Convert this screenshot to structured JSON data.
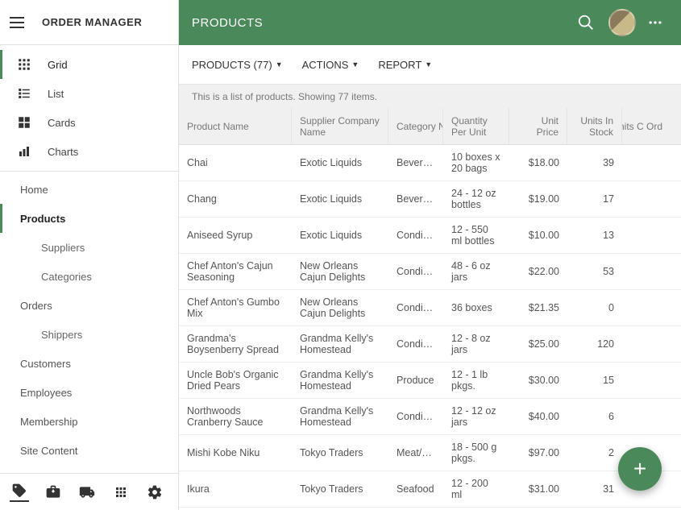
{
  "app_title": "ORDER MANAGER",
  "topbar": {
    "title": "PRODUCTS"
  },
  "view_nav": [
    {
      "key": "grid",
      "label": "Grid",
      "active": true
    },
    {
      "key": "list",
      "label": "List"
    },
    {
      "key": "cards",
      "label": "Cards"
    },
    {
      "key": "charts",
      "label": "Charts"
    }
  ],
  "tree_nav": [
    {
      "label": "Home"
    },
    {
      "label": "Products",
      "active": true
    },
    {
      "label": "Suppliers",
      "child": true
    },
    {
      "label": "Categories",
      "child": true
    },
    {
      "label": "Orders"
    },
    {
      "label": "Shippers",
      "child": true
    },
    {
      "label": "Customers"
    },
    {
      "label": "Employees"
    },
    {
      "label": "Membership"
    },
    {
      "label": "Site Content"
    }
  ],
  "toolbar": {
    "products": "PRODUCTS (77)",
    "actions": "ACTIONS",
    "report": "REPORT"
  },
  "info_text": "This is a list of products. Showing 77 items.",
  "columns": {
    "name": "Product Name",
    "supplier": "Supplier Company Name",
    "category": "Category Name",
    "qty": "Quantity Per Unit",
    "price": "Unit Price",
    "stock": "Units In Stock",
    "order": "Units On Order"
  },
  "column_display": {
    "order": "Units C\nOrd"
  },
  "rows": [
    {
      "name": "Chai",
      "supplier": "Exotic Liquids",
      "category": "Beverag...",
      "qty": "10 boxes x 20 bags",
      "price": "$18.00",
      "stock": "39",
      "order": ""
    },
    {
      "name": "Chang",
      "supplier": "Exotic Liquids",
      "category": "Beverag...",
      "qty": "24 - 12 oz bottles",
      "price": "$19.00",
      "stock": "17",
      "order": ""
    },
    {
      "name": "Aniseed Syrup",
      "supplier": "Exotic Liquids",
      "category": "Condim...",
      "qty": "12 - 550 ml bottles",
      "price": "$10.00",
      "stock": "13",
      "order": ""
    },
    {
      "name": "Chef Anton's Cajun Seasoning",
      "supplier": "New Orleans Cajun Delights",
      "category": "Condim...",
      "qty": "48 - 6 oz jars",
      "price": "$22.00",
      "stock": "53",
      "order": ""
    },
    {
      "name": "Chef Anton's Gumbo Mix",
      "supplier": "New Orleans Cajun Delights",
      "category": "Condim...",
      "qty": "36 boxes",
      "price": "$21.35",
      "stock": "0",
      "order": ""
    },
    {
      "name": "Grandma's Boysenberry Spread",
      "supplier": "Grandma Kelly's Homestead",
      "category": "Condim...",
      "qty": "12 - 8 oz jars",
      "price": "$25.00",
      "stock": "120",
      "order": ""
    },
    {
      "name": "Uncle Bob's Organic Dried Pears",
      "supplier": "Grandma Kelly's Homestead",
      "category": "Produce",
      "qty": "12 - 1 lb pkgs.",
      "price": "$30.00",
      "stock": "15",
      "order": ""
    },
    {
      "name": "Northwoods Cranberry Sauce",
      "supplier": "Grandma Kelly's Homestead",
      "category": "Condim...",
      "qty": "12 - 12 oz jars",
      "price": "$40.00",
      "stock": "6",
      "order": ""
    },
    {
      "name": "Mishi Kobe Niku",
      "supplier": "Tokyo Traders",
      "category": "Meat/P...",
      "qty": "18 - 500 g pkgs.",
      "price": "$97.00",
      "stock": "2",
      "order": ""
    },
    {
      "name": "Ikura",
      "supplier": "Tokyo Traders",
      "category": "Seafood",
      "qty": "12 - 200 ml",
      "price": "$31.00",
      "stock": "31",
      "order": ""
    }
  ],
  "fab_label": "+"
}
